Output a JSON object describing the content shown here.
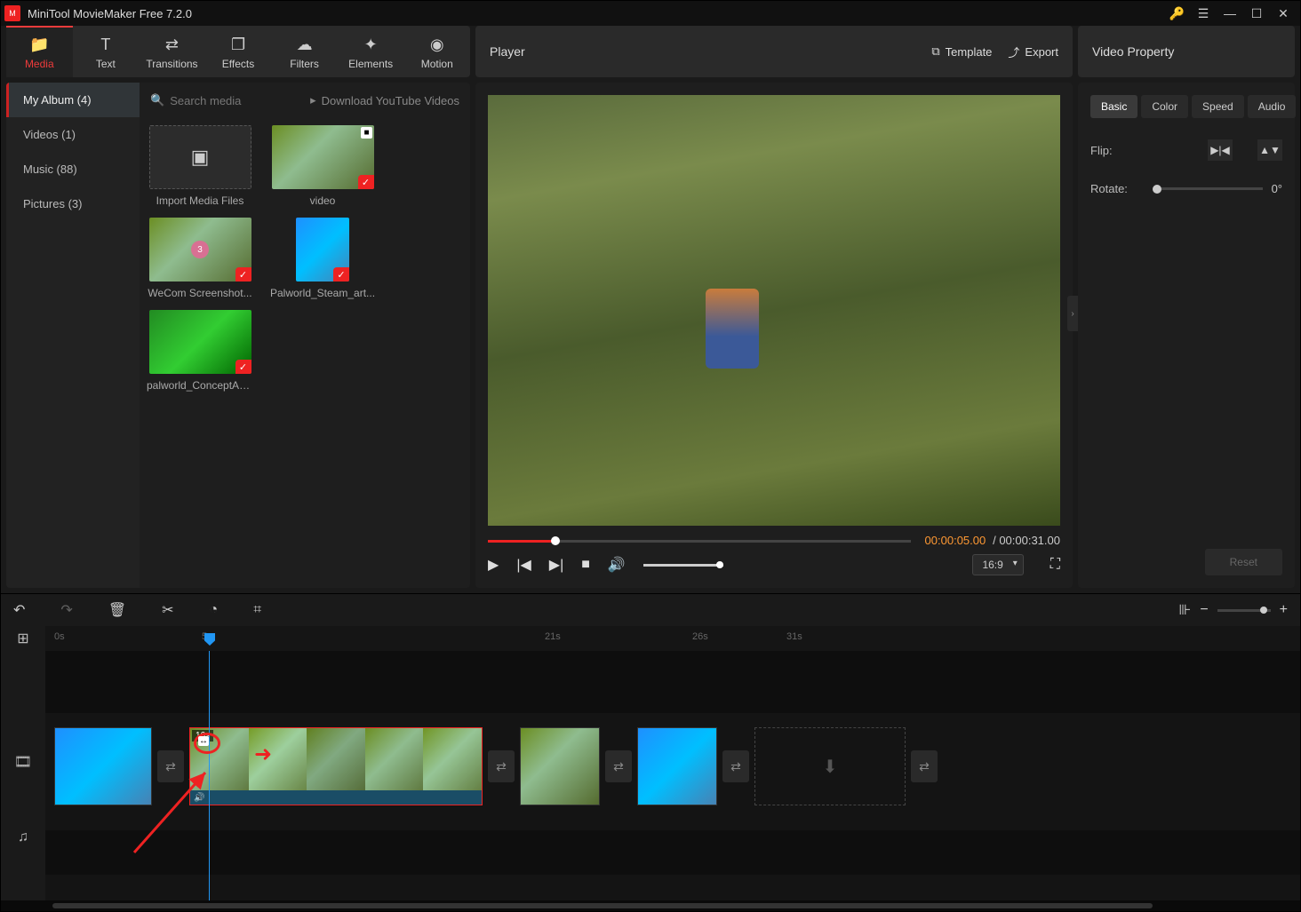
{
  "titlebar": {
    "title": "MiniTool MovieMaker Free 7.2.0"
  },
  "tabs": {
    "media": "Media",
    "text": "Text",
    "transitions": "Transitions",
    "effects": "Effects",
    "filters": "Filters",
    "elements": "Elements",
    "motion": "Motion"
  },
  "player_header": {
    "title": "Player",
    "template": "Template",
    "export": "Export"
  },
  "prop_header": {
    "title": "Video Property"
  },
  "media_sidebar": {
    "album": "My Album (4)",
    "videos": "Videos (1)",
    "music": "Music (88)",
    "pictures": "Pictures (3)"
  },
  "media_topbar": {
    "search_placeholder": "Search media",
    "download": "Download YouTube Videos"
  },
  "media_items": {
    "import": "Import Media Files",
    "video": "video",
    "wecom": "WeCom Screenshot...",
    "palworld_steam": "Palworld_Steam_art...",
    "palworld_concept": "palworld_ConceptArt...",
    "badge_count": "3"
  },
  "player": {
    "current_time": "00:00:05.00",
    "total_time": "00:00:31.00",
    "separator": "/",
    "aspect": "16:9"
  },
  "props": {
    "tab_basic": "Basic",
    "tab_color": "Color",
    "tab_speed": "Speed",
    "tab_audio": "Audio",
    "flip_label": "Flip:",
    "rotate_label": "Rotate:",
    "rotate_value": "0°",
    "reset": "Reset"
  },
  "ruler": {
    "m0": "0s",
    "m5": "5s",
    "m21": "21s",
    "m26": "26s",
    "m31": "31s"
  },
  "clips": {
    "selected_duration": "16s"
  }
}
